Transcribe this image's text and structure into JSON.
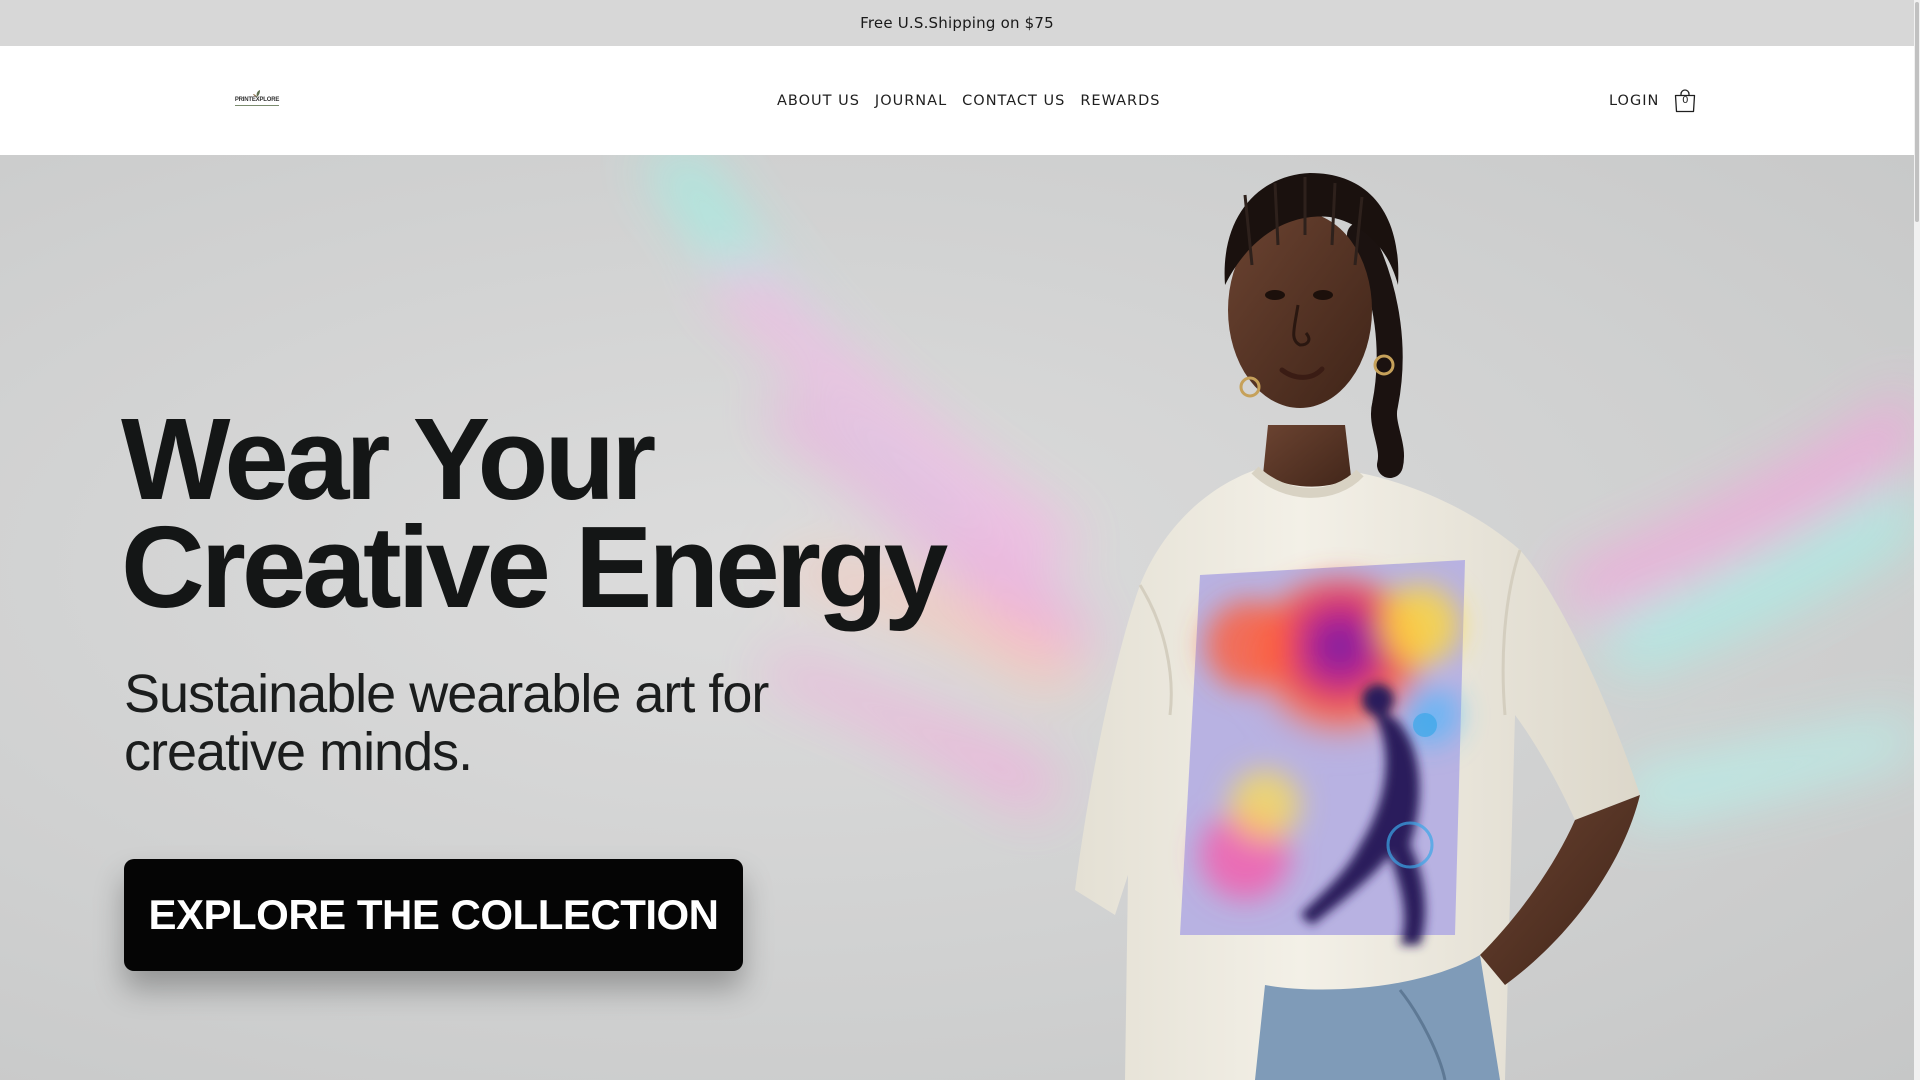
{
  "announcement": {
    "text": "Free U.S.Shipping on $75"
  },
  "header": {
    "logo_text": "PRINTEXPLORE",
    "nav": [
      {
        "label": "ABOUT US"
      },
      {
        "label": "JOURNAL"
      },
      {
        "label": "CONTACT US"
      },
      {
        "label": "REWARDS"
      }
    ],
    "login_label": "LOGIN",
    "cart_count": "0",
    "cart_icon": "shopping-bag-icon"
  },
  "hero": {
    "title_line1": "Wear Your",
    "title_line2": "Creative Energy",
    "subtitle_line1": "Sustainable wearable art for",
    "subtitle_line2": "creative minds.",
    "cta_label": "EXPLORE THE COLLECTION",
    "image_alt_icon": "model-in-graphic-tshirt-image"
  },
  "colors": {
    "announcement_bg": "#d7d7d7",
    "header_bg": "#ffffff",
    "hero_bg": "#d2d3d3",
    "cta_bg": "#050505",
    "cta_text": "#ffffff",
    "title_text": "#141616"
  }
}
